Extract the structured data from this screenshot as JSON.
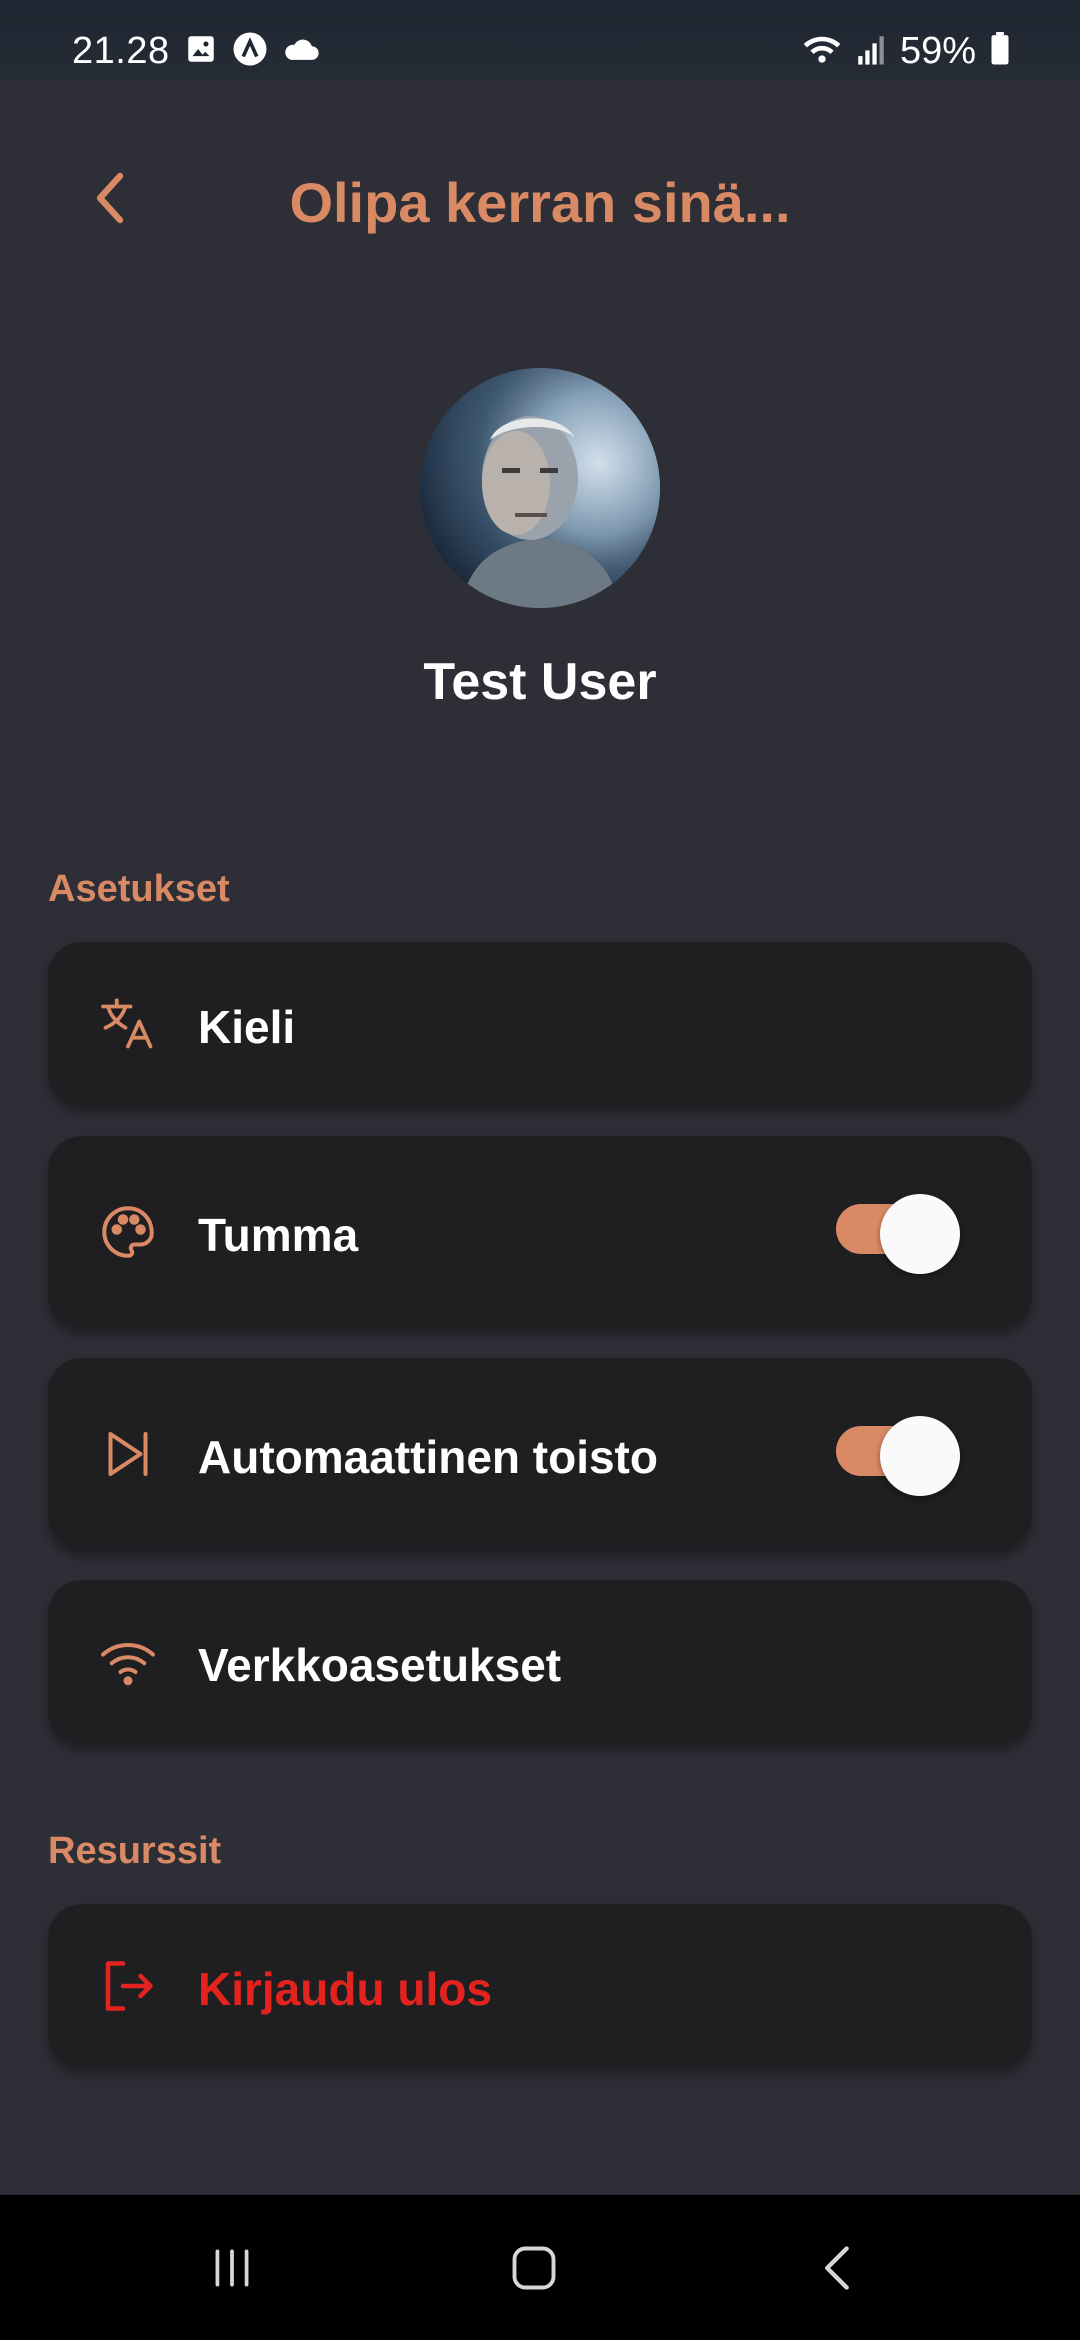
{
  "status_bar": {
    "time": "21.28",
    "battery": "59%",
    "icons": [
      "image-icon",
      "app-a-icon",
      "cloud-icon",
      "wifi-icon",
      "signal-icon",
      "battery-icon"
    ]
  },
  "header": {
    "title": "Olipa kerran sinä...",
    "back_icon": "chevron-left-icon"
  },
  "profile": {
    "name": "Test User"
  },
  "sections": {
    "settings_title": "Asetukset",
    "resources_title": "Resurssit"
  },
  "settings": {
    "language": {
      "label": "Kieli",
      "icon": "translate-icon"
    },
    "dark": {
      "label": "Tumma",
      "icon": "palette-icon",
      "enabled": true
    },
    "autoplay": {
      "label": "Automaattinen toisto",
      "icon": "skip-next-icon",
      "enabled": true
    },
    "network": {
      "label": "Verkkoasetukset",
      "icon": "wifi-icon"
    }
  },
  "resources": {
    "logout": {
      "label": "Kirjaudu ulos",
      "icon": "logout-icon"
    }
  },
  "colors": {
    "accent": "#d98a64",
    "background": "#2d2e36",
    "card": "#1f1f21",
    "danger": "#e4231f"
  }
}
